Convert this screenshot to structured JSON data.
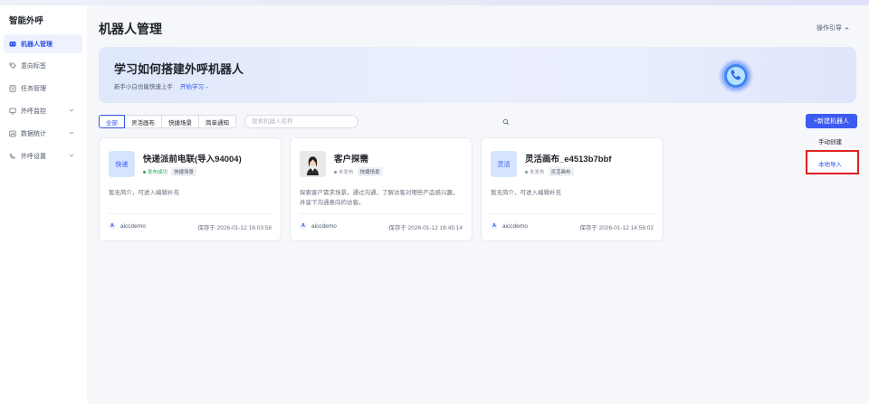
{
  "sidebar": {
    "brand": "智能外呼",
    "items": [
      {
        "label": "机器人管理",
        "icon": "robot-icon",
        "active": true
      },
      {
        "label": "意向标签",
        "icon": "tag-icon"
      },
      {
        "label": "任务管理",
        "icon": "task-icon"
      },
      {
        "label": "外呼监控",
        "icon": "monitor-icon",
        "expandable": true
      },
      {
        "label": "数据统计",
        "icon": "chart-icon",
        "expandable": true
      },
      {
        "label": "外呼设置",
        "icon": "settings-icon",
        "expandable": true
      }
    ]
  },
  "header": {
    "title": "机器人管理",
    "guide_label": "操作引导"
  },
  "banner": {
    "title": "学习如何搭建外呼机器人",
    "subtitle": "新手小白也能快速上手",
    "link": "开始学习→"
  },
  "filters": {
    "tabs": [
      "全部",
      "灵活画布",
      "快捷场景",
      "简单通知"
    ],
    "active_tab": "全部",
    "search_placeholder": "搜索机器人名称"
  },
  "actions": {
    "new_robot": "+新建机器人",
    "dropdown": [
      "手动创建",
      "本地导入"
    ]
  },
  "cards": [
    {
      "avatar_text": "快递",
      "name": "快递派前电联(导入94004)",
      "status": "发布成功",
      "tag": "快捷场景",
      "desc": "暂无简介，可进入编辑补充",
      "owner_initial": "A",
      "owner": "aiccdemo",
      "saved": "保存于 2026-01-12 16:03:58"
    },
    {
      "avatar_text": "",
      "name": "客户探需",
      "status": "未发布",
      "tag": "快捷场景",
      "desc": "探索客户需求场景，通过沟通，了解访客对哪些产品感兴趣，并留下沟通意向的访客。",
      "owner_initial": "A",
      "owner": "aiccdemo",
      "saved": "保存于 2026-01-12 16:45:14"
    },
    {
      "avatar_text": "灵活",
      "name": "灵活画布_e4513b7bbf",
      "status": "未发布",
      "tag": "灵活画布",
      "desc": "暂无简介，可进入编辑补充",
      "owner_initial": "A",
      "owner": "aiccdemo",
      "saved": "保存于 2026-01-12 14:56:02"
    }
  ],
  "colors": {
    "accent": "#3d5af1",
    "link": "#2f54eb",
    "success": "#21a559",
    "highlight_border": "#e02020"
  }
}
